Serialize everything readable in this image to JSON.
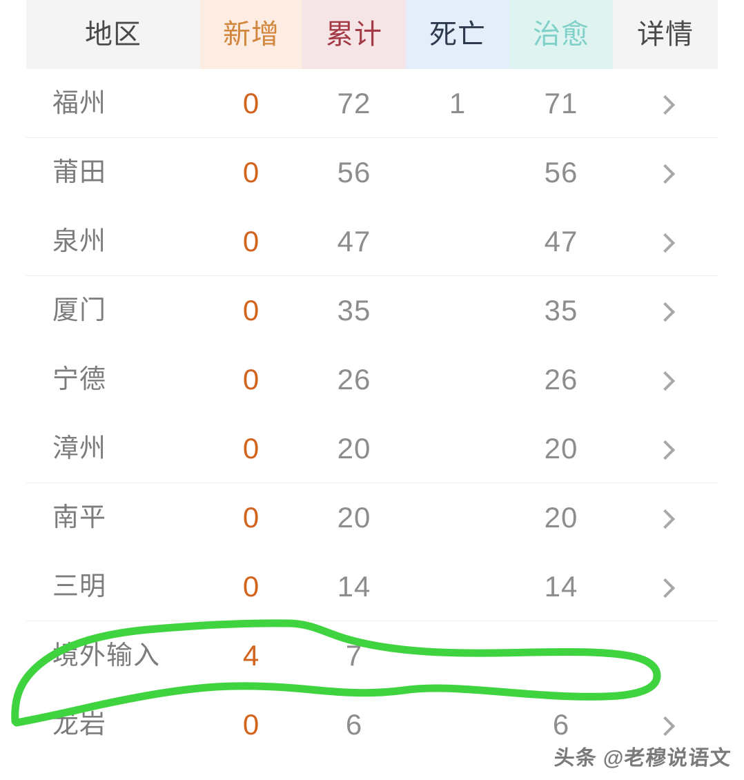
{
  "table": {
    "columns": [
      {
        "key": "region",
        "label": "地区",
        "bg": "#f4f4f5",
        "fg": "#4a4a4a"
      },
      {
        "key": "new",
        "label": "新增",
        "bg": "#fcece2",
        "fg": "#d2853c"
      },
      {
        "key": "total",
        "label": "累计",
        "bg": "#f6e5e6",
        "fg": "#a33a46"
      },
      {
        "key": "death",
        "label": "死亡",
        "bg": "#e4edfa",
        "fg": "#2d3a4d"
      },
      {
        "key": "cured",
        "label": "治愈",
        "bg": "#dff4f1",
        "fg": "#7fd0c8"
      },
      {
        "key": "detail",
        "label": "详情",
        "bg": "#f4f4f5",
        "fg": "#4a4a4a"
      }
    ],
    "rows": [
      {
        "region": "福州",
        "new": "0",
        "total": "72",
        "death": "1",
        "cured": "71",
        "detail": "chevron-right-icon",
        "separator_below": true
      },
      {
        "region": "莆田",
        "new": "0",
        "total": "56",
        "death": "",
        "cured": "56",
        "detail": "chevron-right-icon",
        "separator_below": false
      },
      {
        "region": "泉州",
        "new": "0",
        "total": "47",
        "death": "",
        "cured": "47",
        "detail": "chevron-right-icon",
        "separator_below": true
      },
      {
        "region": "厦门",
        "new": "0",
        "total": "35",
        "death": "",
        "cured": "35",
        "detail": "chevron-right-icon",
        "separator_below": false
      },
      {
        "region": "宁德",
        "new": "0",
        "total": "26",
        "death": "",
        "cured": "26",
        "detail": "chevron-right-icon",
        "separator_below": false
      },
      {
        "region": "漳州",
        "new": "0",
        "total": "20",
        "death": "",
        "cured": "20",
        "detail": "chevron-right-icon",
        "separator_below": true
      },
      {
        "region": "南平",
        "new": "0",
        "total": "20",
        "death": "",
        "cured": "20",
        "detail": "chevron-right-icon",
        "separator_below": false
      },
      {
        "region": "三明",
        "new": "0",
        "total": "14",
        "death": "",
        "cured": "14",
        "detail": "chevron-right-icon",
        "separator_below": true
      },
      {
        "region": "境外输入",
        "new": "4",
        "total": "7",
        "death": "",
        "cured": "",
        "detail": "",
        "separator_below": false
      },
      {
        "region": "龙岩",
        "new": "0",
        "total": "6",
        "death": "",
        "cured": "6",
        "detail": "chevron-right-icon",
        "separator_below": false
      }
    ]
  },
  "annotation": {
    "type": "hand-drawn-lasso",
    "color": "#3fd43f",
    "stroke_width": 11,
    "targets_row_region": "境外输入"
  },
  "watermark": {
    "text": "头条 @老穆说语文",
    "color": "#6f6f6f"
  },
  "colors": {
    "page_background": "#ffffff",
    "header_background": "#f4f4f5",
    "row_separator": "#ededed",
    "new_value": "#d2641e",
    "neutral_value": "#8d8d8d",
    "region_label": "#7c7c7c",
    "chevron": "#a8a8a8",
    "annotation_green": "#3fd43f"
  }
}
